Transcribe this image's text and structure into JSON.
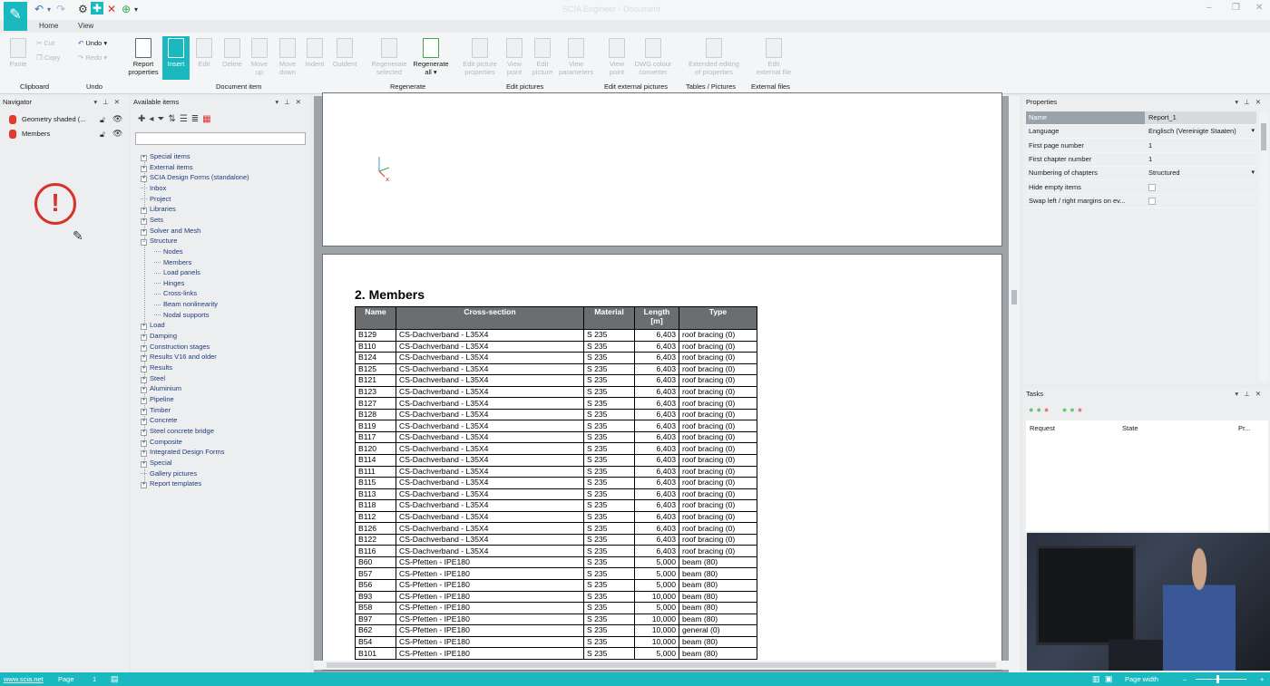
{
  "titlebar": {
    "title": "SCIA Engineer - Document",
    "controls": [
      "–",
      "❐",
      "✕"
    ]
  },
  "menu": {
    "tabs": [
      "Home",
      "View"
    ]
  },
  "ribbon": {
    "clipboard": {
      "paste": "Paste",
      "cut": "Cut",
      "copy": "Copy",
      "group": "Clipboard"
    },
    "undo": {
      "undo": "Undo",
      "redo": "Redo",
      "group": "Undo"
    },
    "document_item": {
      "report_properties": [
        "Report",
        "properties"
      ],
      "insert": "Insert",
      "edit": "Edit",
      "delete": "Delete",
      "move_up": [
        "Move",
        "up"
      ],
      "move_down": [
        "Move",
        "down"
      ],
      "indent": "Indent",
      "outdent": "Outdent",
      "group": "Document item"
    },
    "regenerate": {
      "regenerate_selected": [
        "Regenerate",
        "selected"
      ],
      "regenerate_all": [
        "Regenerate",
        "all"
      ],
      "group": "Regenerate"
    },
    "edit_pictures": {
      "edit_picture_properties": [
        "Edit picture",
        "properties"
      ],
      "view_point": [
        "View",
        "point"
      ],
      "edit_picture": [
        "Edit",
        "picture"
      ],
      "view_parameters": [
        "View",
        "parameters"
      ],
      "group": "Edit pictures"
    },
    "edit_external_pictures": {
      "view_point": [
        "View",
        "point"
      ],
      "dwg_colour_converter": [
        "DWG colour",
        "converter"
      ],
      "group": "Edit external pictures"
    },
    "tables_pictures": {
      "extended_editing": [
        "Extended editing",
        "of properties"
      ],
      "group": "Tables / Pictures"
    },
    "external_files": {
      "edit_external_file": [
        "Edit",
        "external file"
      ],
      "group": "External files"
    }
  },
  "navigator": {
    "title": "Navigator",
    "items": [
      {
        "label": "Geometry shaded (..."
      },
      {
        "label": "Members"
      }
    ]
  },
  "available": {
    "title": "Available items",
    "tree": [
      {
        "label": "Special items",
        "expand": true,
        "level": 0
      },
      {
        "label": "External items",
        "expand": true,
        "level": 0
      },
      {
        "label": "SCIA Design Forms (standalone)",
        "expand": true,
        "level": 0
      },
      {
        "label": "Inbox",
        "expand": false,
        "level": 0
      },
      {
        "label": "Project",
        "expand": false,
        "level": 0
      },
      {
        "label": "Libraries",
        "expand": true,
        "level": 0
      },
      {
        "label": "Sets",
        "expand": true,
        "level": 0
      },
      {
        "label": "Solver and Mesh",
        "expand": true,
        "level": 0
      },
      {
        "label": "Structure",
        "expand": true,
        "open": true,
        "level": 0
      },
      {
        "label": "Nodes",
        "expand": false,
        "level": 1
      },
      {
        "label": "Members",
        "expand": false,
        "level": 1
      },
      {
        "label": "Load panels",
        "expand": false,
        "level": 1
      },
      {
        "label": "Hinges",
        "expand": false,
        "level": 1
      },
      {
        "label": "Cross-links",
        "expand": false,
        "level": 1
      },
      {
        "label": "Beam nonlinearity",
        "expand": false,
        "level": 1
      },
      {
        "label": "Nodal supports",
        "expand": false,
        "level": 1
      },
      {
        "label": "Load",
        "expand": true,
        "level": 0
      },
      {
        "label": "Damping",
        "expand": true,
        "level": 0
      },
      {
        "label": "Construction stages",
        "expand": true,
        "level": 0
      },
      {
        "label": "Results V16 and older",
        "expand": true,
        "level": 0
      },
      {
        "label": "Results",
        "expand": true,
        "level": 0
      },
      {
        "label": "Steel",
        "expand": true,
        "level": 0
      },
      {
        "label": "Aluminium",
        "expand": true,
        "level": 0
      },
      {
        "label": "Pipeline",
        "expand": true,
        "level": 0
      },
      {
        "label": "Timber",
        "expand": true,
        "level": 0
      },
      {
        "label": "Concrete",
        "expand": true,
        "level": 0
      },
      {
        "label": "Steel concrete bridge",
        "expand": true,
        "level": 0
      },
      {
        "label": "Composite",
        "expand": true,
        "level": 0
      },
      {
        "label": "Integrated Design Forms",
        "expand": true,
        "level": 0
      },
      {
        "label": "Special",
        "expand": true,
        "level": 0
      },
      {
        "label": "Gallery pictures",
        "expand": false,
        "level": 0
      },
      {
        "label": "Report templates",
        "expand": true,
        "level": 0
      }
    ]
  },
  "document": {
    "axis_label": "x",
    "section_title": "2. Members",
    "table": {
      "headers": [
        "Name",
        "Cross-section",
        "Material",
        "Length\n[m]",
        "Type"
      ],
      "rows": [
        [
          "B129",
          "CS-Dachverband - L35X4",
          "S 235",
          "6,403",
          "roof bracing (0)"
        ],
        [
          "B110",
          "CS-Dachverband - L35X4",
          "S 235",
          "6,403",
          "roof bracing (0)"
        ],
        [
          "B124",
          "CS-Dachverband - L35X4",
          "S 235",
          "6,403",
          "roof bracing (0)"
        ],
        [
          "B125",
          "CS-Dachverband - L35X4",
          "S 235",
          "6,403",
          "roof bracing (0)"
        ],
        [
          "B121",
          "CS-Dachverband - L35X4",
          "S 235",
          "6,403",
          "roof bracing (0)"
        ],
        [
          "B123",
          "CS-Dachverband - L35X4",
          "S 235",
          "6,403",
          "roof bracing (0)"
        ],
        [
          "B127",
          "CS-Dachverband - L35X4",
          "S 235",
          "6,403",
          "roof bracing (0)"
        ],
        [
          "B128",
          "CS-Dachverband - L35X4",
          "S 235",
          "6,403",
          "roof bracing (0)"
        ],
        [
          "B119",
          "CS-Dachverband - L35X4",
          "S 235",
          "6,403",
          "roof bracing (0)"
        ],
        [
          "B117",
          "CS-Dachverband - L35X4",
          "S 235",
          "6,403",
          "roof bracing (0)"
        ],
        [
          "B120",
          "CS-Dachverband - L35X4",
          "S 235",
          "6,403",
          "roof bracing (0)"
        ],
        [
          "B114",
          "CS-Dachverband - L35X4",
          "S 235",
          "6,403",
          "roof bracing (0)"
        ],
        [
          "B111",
          "CS-Dachverband - L35X4",
          "S 235",
          "6,403",
          "roof bracing (0)"
        ],
        [
          "B115",
          "CS-Dachverband - L35X4",
          "S 235",
          "6,403",
          "roof bracing (0)"
        ],
        [
          "B113",
          "CS-Dachverband - L35X4",
          "S 235",
          "6,403",
          "roof bracing (0)"
        ],
        [
          "B118",
          "CS-Dachverband - L35X4",
          "S 235",
          "6,403",
          "roof bracing (0)"
        ],
        [
          "B112",
          "CS-Dachverband - L35X4",
          "S 235",
          "6,403",
          "roof bracing (0)"
        ],
        [
          "B126",
          "CS-Dachverband - L35X4",
          "S 235",
          "6,403",
          "roof bracing (0)"
        ],
        [
          "B122",
          "CS-Dachverband - L35X4",
          "S 235",
          "6,403",
          "roof bracing (0)"
        ],
        [
          "B116",
          "CS-Dachverband - L35X4",
          "S 235",
          "6,403",
          "roof bracing (0)"
        ],
        [
          "B60",
          "CS-Pfetten - IPE180",
          "S 235",
          "5,000",
          "beam (80)"
        ],
        [
          "B57",
          "CS-Pfetten - IPE180",
          "S 235",
          "5,000",
          "beam (80)"
        ],
        [
          "B56",
          "CS-Pfetten - IPE180",
          "S 235",
          "5,000",
          "beam (80)"
        ],
        [
          "B93",
          "CS-Pfetten - IPE180",
          "S 235",
          "10,000",
          "beam (80)"
        ],
        [
          "B58",
          "CS-Pfetten - IPE180",
          "S 235",
          "5,000",
          "beam (80)"
        ],
        [
          "B97",
          "CS-Pfetten - IPE180",
          "S 235",
          "10,000",
          "beam (80)"
        ],
        [
          "B62",
          "CS-Pfetten - IPE180",
          "S 235",
          "10,000",
          "general (0)"
        ],
        [
          "B54",
          "CS-Pfetten - IPE180",
          "S 235",
          "10,000",
          "beam (80)"
        ],
        [
          "B101",
          "CS-Pfetten - IPE180",
          "S 235",
          "5,000",
          "beam (80)"
        ]
      ]
    }
  },
  "properties": {
    "title": "Properties",
    "rows": [
      {
        "key": "Name",
        "value": "Report_1"
      },
      {
        "key": "Language",
        "value": "Englisch (Vereinigte Staaten)"
      },
      {
        "key": "First page number",
        "value": "1"
      },
      {
        "key": "First chapter number",
        "value": "1"
      },
      {
        "key": "Numbering of chapters",
        "value": "Structured"
      },
      {
        "key": "Hide empty items",
        "value": ""
      },
      {
        "key": "Swap left / right margins on ev...",
        "value": ""
      }
    ]
  },
  "tasks": {
    "title": "Tasks",
    "columns": [
      "Request",
      "State",
      "Pr..."
    ]
  },
  "statusbar": {
    "url": "www.scia.net",
    "page_label": "Page",
    "page_value": "1",
    "zoom_mode": "Page width"
  },
  "colors": {
    "accent": "#19b9bf",
    "error": "#d8332a",
    "table_header": "#6b6e71"
  }
}
